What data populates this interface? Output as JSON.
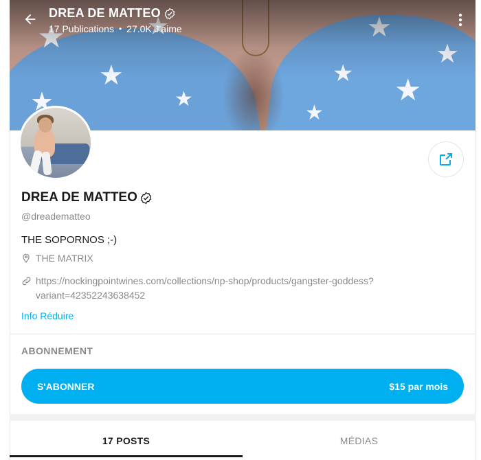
{
  "header": {
    "name": "DREA DE MATTEO",
    "publications": "17 Publications",
    "separator": "•",
    "likes": "27.0K J'aime"
  },
  "profile": {
    "name": "DREA DE MATTEO",
    "handle": "@dreadematteo",
    "bio": "THE SOPORNOS ;-)",
    "location": "THE MATRIX",
    "website": "https://nockingpointwines.com/collections/np-shop/products/gangster-goddess?variant=42352243638452",
    "info_link": "Info Réduire"
  },
  "subscription": {
    "label": "ABONNEMENT",
    "button_label": "S'ABONNER",
    "price": "$15 par mois"
  },
  "tabs": [
    {
      "label": "17 POSTS",
      "active": true
    },
    {
      "label": "MÉDIAS",
      "active": false
    }
  ],
  "icons": {
    "back": "arrow-left-icon",
    "more": "more-vertical-icon",
    "verified": "verified-badge-icon",
    "share": "share-icon",
    "location": "map-pin-icon",
    "link": "link-icon"
  },
  "colors": {
    "accent": "#00aff0",
    "text": "#1a1a1a",
    "muted": "#8a8a8a"
  }
}
